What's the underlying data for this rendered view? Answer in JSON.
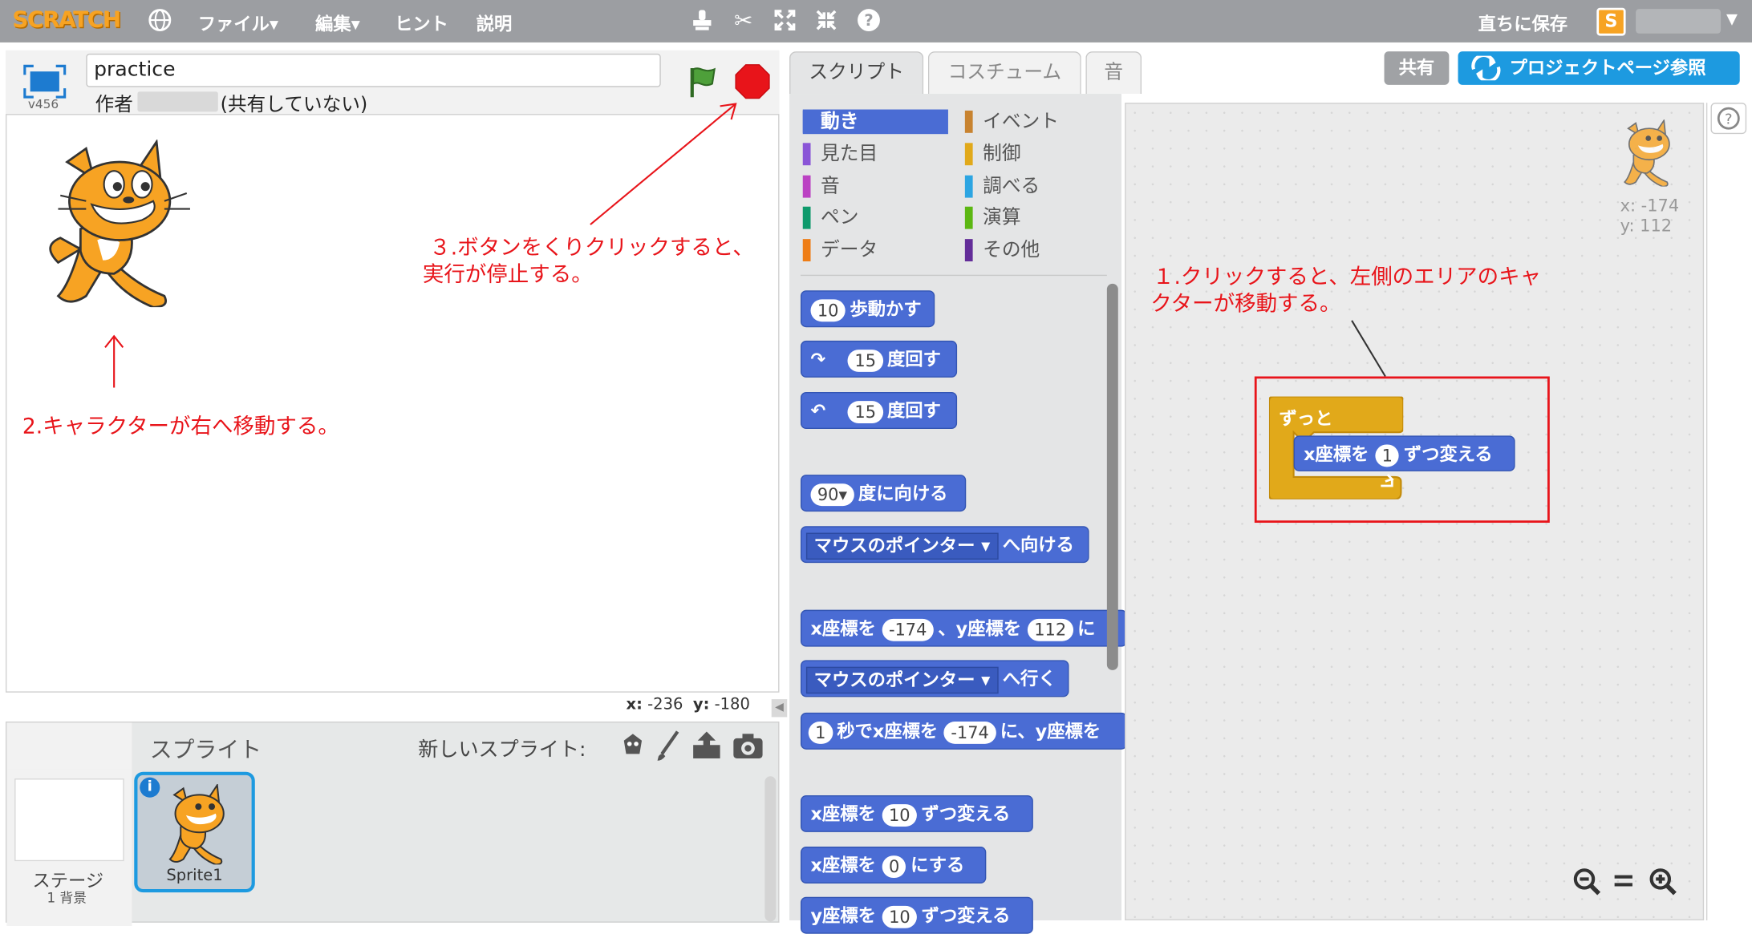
{
  "topbar": {
    "logo": "SCRATCH",
    "menu": [
      "ファイル▾",
      "編集▾",
      "ヒント",
      "説明"
    ],
    "save_now": "直ちに保存"
  },
  "stage": {
    "project_name": "practice",
    "version": "v456",
    "author_label": "作者",
    "share_status": "(共有していない)",
    "mouse_x_label": "x:",
    "mouse_x": "-236",
    "mouse_y_label": "y:",
    "mouse_y": "-180"
  },
  "annotations": {
    "a1_line1": "１.クリックすると、左側のエリアのキャ",
    "a1_line2": "クターが移動する。",
    "a2": "2.キャラクターが右へ移動する。",
    "a3_line1": "３.ボタンをくりクリックすると、",
    "a3_line2": "実行が停止する。"
  },
  "sprites": {
    "title": "スプライト",
    "new_sprite": "新しいスプライト:",
    "stage_label": "ステージ",
    "stage_backdrops": "1 背景",
    "sprite1": "Sprite1"
  },
  "tabs": [
    "スクリプト",
    "コスチューム",
    "音"
  ],
  "buttons": {
    "share": "共有",
    "project_page": "プロジェクトページ参照"
  },
  "categories": {
    "left": [
      "動き",
      "見た目",
      "音",
      "ペン",
      "データ"
    ],
    "right": [
      "イベント",
      "制御",
      "調べる",
      "演算",
      "その他"
    ],
    "colors_left": [
      "#4a6cd4",
      "#8a55d7",
      "#bb42c3",
      "#0e9a6c",
      "#ee7d16"
    ],
    "colors_right": [
      "#c88330",
      "#e1a91a",
      "#2ca5e2",
      "#5cb712",
      "#632d99"
    ]
  },
  "blocks": {
    "move_num": "10",
    "move_text": "歩動かす",
    "turn_r_num": "15",
    "turn_r_text": "度回す",
    "turn_l_num": "15",
    "turn_l_text": "度回す",
    "point_dir_num": "90▾",
    "point_dir_text": "度に向ける",
    "point_towards_dd": "マウスのポインター ▾",
    "point_towards_text": "へ向ける",
    "goto_xy_a": "x座標を",
    "goto_xy_x": "-174",
    "goto_xy_b": "、y座標を",
    "goto_xy_y": "112",
    "goto_xy_c": "に",
    "goto_dd": "マウスのポインター ▾",
    "goto_text": "へ行く",
    "glide_num": "1",
    "glide_a": "秒でx座標を",
    "glide_x": "-174",
    "glide_b": "に、y座標を",
    "change_x_a": "x座標を",
    "change_x_num": "10",
    "change_x_b": "ずつ変える",
    "set_x_a": "x座標を",
    "set_x_num": "0",
    "set_x_b": "にする",
    "change_y_a": "y座標を",
    "change_y_num": "10",
    "change_y_b": "ずつ変える"
  },
  "script": {
    "forever": "ずっと",
    "inner_a": "x座標を",
    "inner_num": "1",
    "inner_b": "ずつ変える",
    "sprite_x": "x: -174",
    "sprite_y": "y: 112"
  },
  "zoom": [
    "−",
    "=",
    "+"
  ]
}
